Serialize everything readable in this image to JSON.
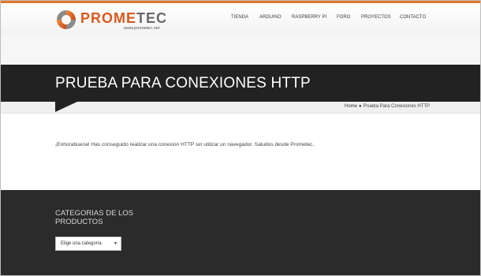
{
  "header": {
    "logo": {
      "text_a": "PROME",
      "text_b": "TEC",
      "tagline": "www.prometec.net"
    },
    "nav": [
      {
        "label": "TIENDA"
      },
      {
        "label": "ARDUINO"
      },
      {
        "label": "RASPBERRY PI"
      },
      {
        "label": "FORO"
      },
      {
        "label": "PROYECTOS"
      },
      {
        "label": "CONTACTO"
      }
    ]
  },
  "page": {
    "title": "PRUEBA PARA CONEXIONES HTTP",
    "breadcrumb": {
      "home": "Home",
      "separator": "●",
      "current": "Prueba Para Conexiones HTTP"
    }
  },
  "content": {
    "message": "¡Enhorabuena! Has conseguido realizar una conexion HTTP sin utilizar un navegador. Saludos desde Prometec."
  },
  "footer": {
    "heading": "CATEGORIAS DE LOS PRODUCTOS",
    "category_select": {
      "selected": "Elige una categoría",
      "arrow": "▼"
    }
  },
  "colors": {
    "accent": "#e0782b",
    "logo_orange": "#d85a1f",
    "title_bar": "#222222",
    "footer": "#2b2b2b"
  }
}
